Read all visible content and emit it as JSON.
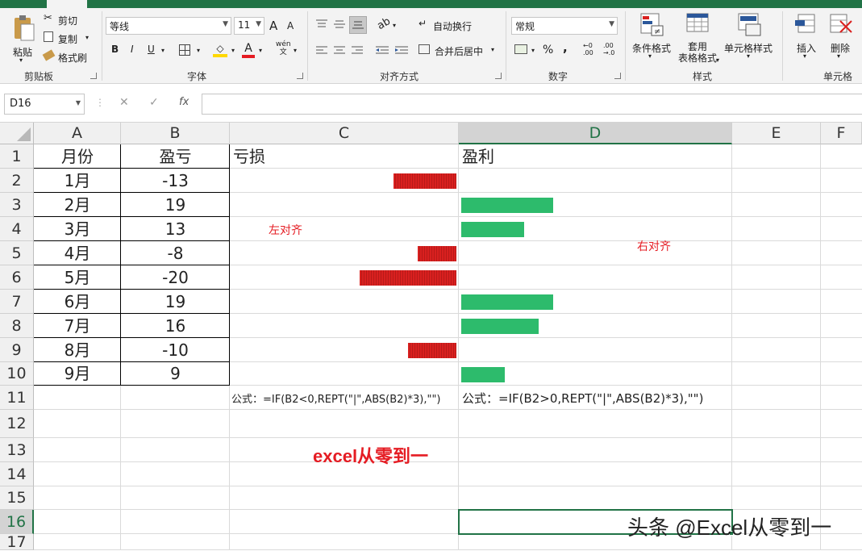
{
  "ribbon": {
    "clipboard": {
      "paste": "粘贴",
      "cut": "剪切",
      "copy": "复制",
      "format_painter": "格式刷",
      "group": "剪贴板"
    },
    "font": {
      "name": "等线",
      "size": "11",
      "bold": "B",
      "italic": "I",
      "underline": "U",
      "grow": "A",
      "shrink": "A",
      "font_color_glyph": "A",
      "phonetic": "wén\n文",
      "group": "字体"
    },
    "alignment": {
      "wrap": "自动换行",
      "merge": "合并后居中",
      "group": "对齐方式"
    },
    "number": {
      "format": "常规",
      "percent": "%",
      "comma": ",",
      "group": "数字"
    },
    "styles": {
      "conditional": "条件格式",
      "table": "套用\n表格格式",
      "cell_styles": "单元格样式",
      "group": "样式"
    },
    "cells": {
      "insert": "插入",
      "delete": "删除",
      "group": "单元格"
    }
  },
  "formula_bar": {
    "name_box": "D16",
    "cancel": "✕",
    "enter": "✓",
    "fx": "fx",
    "value": ""
  },
  "columns": [
    "A",
    "B",
    "C",
    "D",
    "E",
    "F"
  ],
  "rows": [
    "1",
    "2",
    "3",
    "4",
    "5",
    "6",
    "7",
    "8",
    "9",
    "10",
    "11",
    "12",
    "13",
    "14",
    "15",
    "16",
    "17"
  ],
  "cells": {
    "a1": "月份",
    "b1": "盈亏",
    "c1": "亏损",
    "d1": "盈利",
    "months": [
      "1月",
      "2月",
      "3月",
      "4月",
      "5月",
      "6月",
      "7月",
      "8月",
      "9月"
    ],
    "values": [
      "-13",
      "19",
      "13",
      "-8",
      "-20",
      "19",
      "16",
      "-10",
      "9"
    ],
    "note_left": "左对齐",
    "note_right": "右对齐",
    "formula_c": "公式：=IF(B2<0,REPT(\"|\",ABS(B2)*3),\"\")",
    "formula_d": "公式：=IF(B2>0,REPT(\"|\",ABS(B2)*3),\"\")",
    "title13": "excel从零到一",
    "watermark": "头条 @Excel从零到一"
  },
  "chart_data": {
    "type": "bar",
    "categories": [
      "1月",
      "2月",
      "3月",
      "4月",
      "5月",
      "6月",
      "7月",
      "8月",
      "9月"
    ],
    "values": [
      -13,
      19,
      13,
      -8,
      -20,
      19,
      16,
      -10,
      9
    ],
    "colors": {
      "loss": "#d9201f",
      "profit": "#2dbb6c"
    }
  }
}
